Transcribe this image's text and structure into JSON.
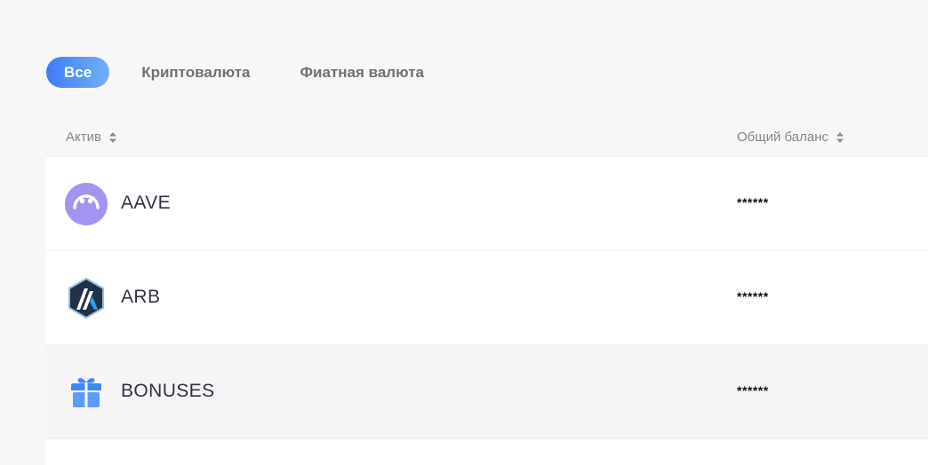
{
  "tabs": [
    {
      "label": "Все",
      "active": true
    },
    {
      "label": "Криптовалюта",
      "active": false
    },
    {
      "label": "Фиатная валюта",
      "active": false
    }
  ],
  "table": {
    "columns": {
      "asset": "Актив",
      "balance": "Общий баланс"
    },
    "rows": [
      {
        "asset": "AAVE",
        "icon": "aave-icon",
        "balance": "******"
      },
      {
        "asset": "ARB",
        "icon": "arb-icon",
        "balance": "******"
      },
      {
        "asset": "BONUSES",
        "icon": "gift-icon",
        "balance": "******"
      }
    ]
  },
  "colors": {
    "accent_start": "#3f7cf3",
    "accent_end": "#6fb1f7",
    "aave": "#9b8bf0",
    "arb_dark": "#213147",
    "arb_blue": "#28a0f0",
    "gift": "#3d8af7"
  }
}
